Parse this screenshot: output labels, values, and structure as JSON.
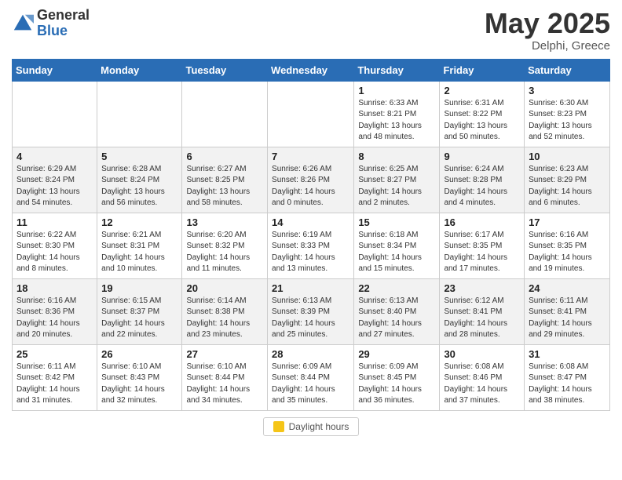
{
  "header": {
    "logo_general": "General",
    "logo_blue": "Blue",
    "month_title": "May 2025",
    "location": "Delphi, Greece"
  },
  "calendar": {
    "weekdays": [
      "Sunday",
      "Monday",
      "Tuesday",
      "Wednesday",
      "Thursday",
      "Friday",
      "Saturday"
    ],
    "weeks": [
      [
        {
          "day": "",
          "info": ""
        },
        {
          "day": "",
          "info": ""
        },
        {
          "day": "",
          "info": ""
        },
        {
          "day": "",
          "info": ""
        },
        {
          "day": "1",
          "info": "Sunrise: 6:33 AM\nSunset: 8:21 PM\nDaylight: 13 hours\nand 48 minutes."
        },
        {
          "day": "2",
          "info": "Sunrise: 6:31 AM\nSunset: 8:22 PM\nDaylight: 13 hours\nand 50 minutes."
        },
        {
          "day": "3",
          "info": "Sunrise: 6:30 AM\nSunset: 8:23 PM\nDaylight: 13 hours\nand 52 minutes."
        }
      ],
      [
        {
          "day": "4",
          "info": "Sunrise: 6:29 AM\nSunset: 8:24 PM\nDaylight: 13 hours\nand 54 minutes."
        },
        {
          "day": "5",
          "info": "Sunrise: 6:28 AM\nSunset: 8:24 PM\nDaylight: 13 hours\nand 56 minutes."
        },
        {
          "day": "6",
          "info": "Sunrise: 6:27 AM\nSunset: 8:25 PM\nDaylight: 13 hours\nand 58 minutes."
        },
        {
          "day": "7",
          "info": "Sunrise: 6:26 AM\nSunset: 8:26 PM\nDaylight: 14 hours\nand 0 minutes."
        },
        {
          "day": "8",
          "info": "Sunrise: 6:25 AM\nSunset: 8:27 PM\nDaylight: 14 hours\nand 2 minutes."
        },
        {
          "day": "9",
          "info": "Sunrise: 6:24 AM\nSunset: 8:28 PM\nDaylight: 14 hours\nand 4 minutes."
        },
        {
          "day": "10",
          "info": "Sunrise: 6:23 AM\nSunset: 8:29 PM\nDaylight: 14 hours\nand 6 minutes."
        }
      ],
      [
        {
          "day": "11",
          "info": "Sunrise: 6:22 AM\nSunset: 8:30 PM\nDaylight: 14 hours\nand 8 minutes."
        },
        {
          "day": "12",
          "info": "Sunrise: 6:21 AM\nSunset: 8:31 PM\nDaylight: 14 hours\nand 10 minutes."
        },
        {
          "day": "13",
          "info": "Sunrise: 6:20 AM\nSunset: 8:32 PM\nDaylight: 14 hours\nand 11 minutes."
        },
        {
          "day": "14",
          "info": "Sunrise: 6:19 AM\nSunset: 8:33 PM\nDaylight: 14 hours\nand 13 minutes."
        },
        {
          "day": "15",
          "info": "Sunrise: 6:18 AM\nSunset: 8:34 PM\nDaylight: 14 hours\nand 15 minutes."
        },
        {
          "day": "16",
          "info": "Sunrise: 6:17 AM\nSunset: 8:35 PM\nDaylight: 14 hours\nand 17 minutes."
        },
        {
          "day": "17",
          "info": "Sunrise: 6:16 AM\nSunset: 8:35 PM\nDaylight: 14 hours\nand 19 minutes."
        }
      ],
      [
        {
          "day": "18",
          "info": "Sunrise: 6:16 AM\nSunset: 8:36 PM\nDaylight: 14 hours\nand 20 minutes."
        },
        {
          "day": "19",
          "info": "Sunrise: 6:15 AM\nSunset: 8:37 PM\nDaylight: 14 hours\nand 22 minutes."
        },
        {
          "day": "20",
          "info": "Sunrise: 6:14 AM\nSunset: 8:38 PM\nDaylight: 14 hours\nand 23 minutes."
        },
        {
          "day": "21",
          "info": "Sunrise: 6:13 AM\nSunset: 8:39 PM\nDaylight: 14 hours\nand 25 minutes."
        },
        {
          "day": "22",
          "info": "Sunrise: 6:13 AM\nSunset: 8:40 PM\nDaylight: 14 hours\nand 27 minutes."
        },
        {
          "day": "23",
          "info": "Sunrise: 6:12 AM\nSunset: 8:41 PM\nDaylight: 14 hours\nand 28 minutes."
        },
        {
          "day": "24",
          "info": "Sunrise: 6:11 AM\nSunset: 8:41 PM\nDaylight: 14 hours\nand 29 minutes."
        }
      ],
      [
        {
          "day": "25",
          "info": "Sunrise: 6:11 AM\nSunset: 8:42 PM\nDaylight: 14 hours\nand 31 minutes."
        },
        {
          "day": "26",
          "info": "Sunrise: 6:10 AM\nSunset: 8:43 PM\nDaylight: 14 hours\nand 32 minutes."
        },
        {
          "day": "27",
          "info": "Sunrise: 6:10 AM\nSunset: 8:44 PM\nDaylight: 14 hours\nand 34 minutes."
        },
        {
          "day": "28",
          "info": "Sunrise: 6:09 AM\nSunset: 8:44 PM\nDaylight: 14 hours\nand 35 minutes."
        },
        {
          "day": "29",
          "info": "Sunrise: 6:09 AM\nSunset: 8:45 PM\nDaylight: 14 hours\nand 36 minutes."
        },
        {
          "day": "30",
          "info": "Sunrise: 6:08 AM\nSunset: 8:46 PM\nDaylight: 14 hours\nand 37 minutes."
        },
        {
          "day": "31",
          "info": "Sunrise: 6:08 AM\nSunset: 8:47 PM\nDaylight: 14 hours\nand 38 minutes."
        }
      ]
    ]
  },
  "footer": {
    "label": "Daylight hours"
  }
}
